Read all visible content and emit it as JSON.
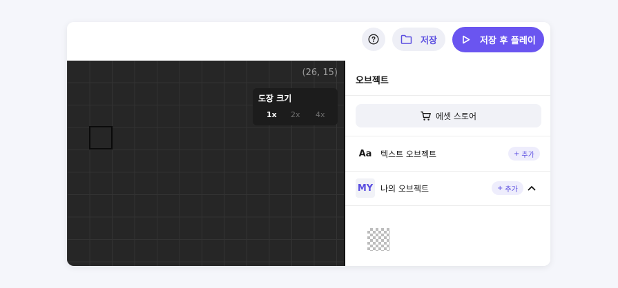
{
  "toolbar": {
    "help_icon": "question-circle-icon",
    "save_label": "저장",
    "save_icon": "folder-icon",
    "play_label": "저장 후 플레이",
    "play_icon": "play-icon"
  },
  "canvas": {
    "coordinate": "(26, 15)",
    "stamp_size": {
      "title": "도장 크기",
      "options": [
        "1x",
        "2x",
        "4x"
      ],
      "selected": "1x"
    }
  },
  "panel": {
    "title": "오브젝트",
    "asset_store_label": "에셋 스토어",
    "asset_store_icon": "cart-icon",
    "rows": [
      {
        "icon_text": "Aa",
        "label": "텍스트 오브젝트",
        "add_label": "추가"
      },
      {
        "icon_text": "MY",
        "label": "나의 오브젝트",
        "add_label": "추가",
        "expanded": true
      }
    ]
  },
  "colors": {
    "accent": "#6a55f0",
    "accent_text": "#5b4ee0",
    "canvas_bg": "#262626",
    "pill_bg": "#eeeff6"
  }
}
